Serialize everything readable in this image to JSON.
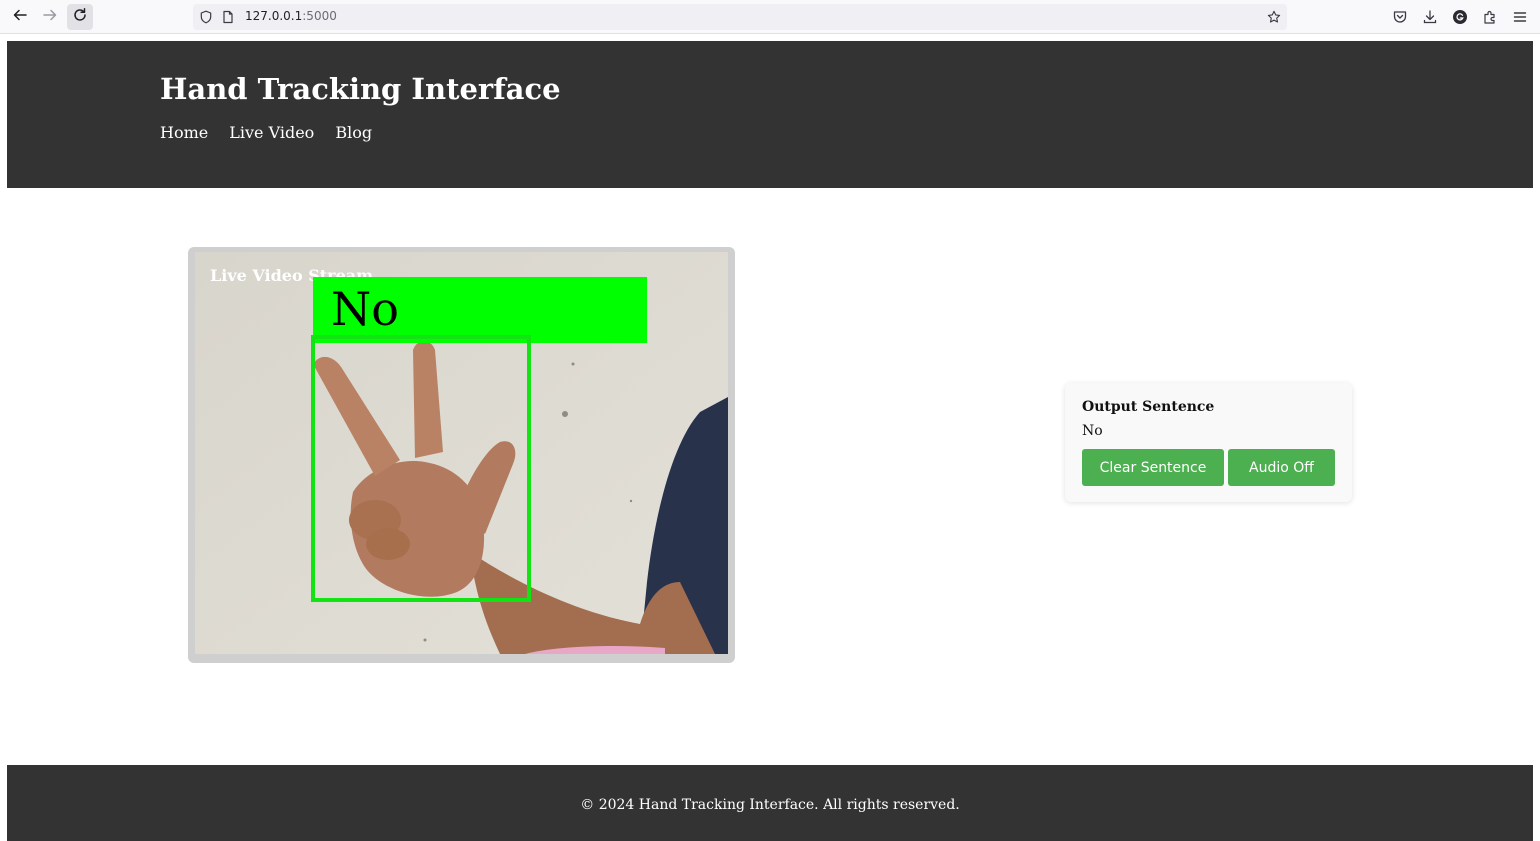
{
  "browser": {
    "url_host": "127.0.0.1",
    "url_port": ":5000"
  },
  "header": {
    "title": "Hand Tracking Interface",
    "nav": [
      "Home",
      "Live Video",
      "Blog"
    ]
  },
  "video": {
    "caption": "Live Video Stream",
    "detected_label": "No",
    "colors": {
      "label_banner": "#00ff00",
      "bounding_box": "#12e312"
    }
  },
  "output": {
    "title": "Output Sentence",
    "sentence": "No",
    "clear_button": "Clear Sentence",
    "audio_button": "Audio Off",
    "button_color": "#4caf50"
  },
  "footer": {
    "text": "© 2024 Hand Tracking Interface. All rights reserved."
  },
  "icons": [
    "back-arrow-icon",
    "forward-arrow-icon",
    "reload-icon",
    "shield-icon",
    "page-icon",
    "star-icon",
    "pocket-icon",
    "download-icon",
    "account-icon",
    "extensions-icon",
    "menu-icon"
  ]
}
